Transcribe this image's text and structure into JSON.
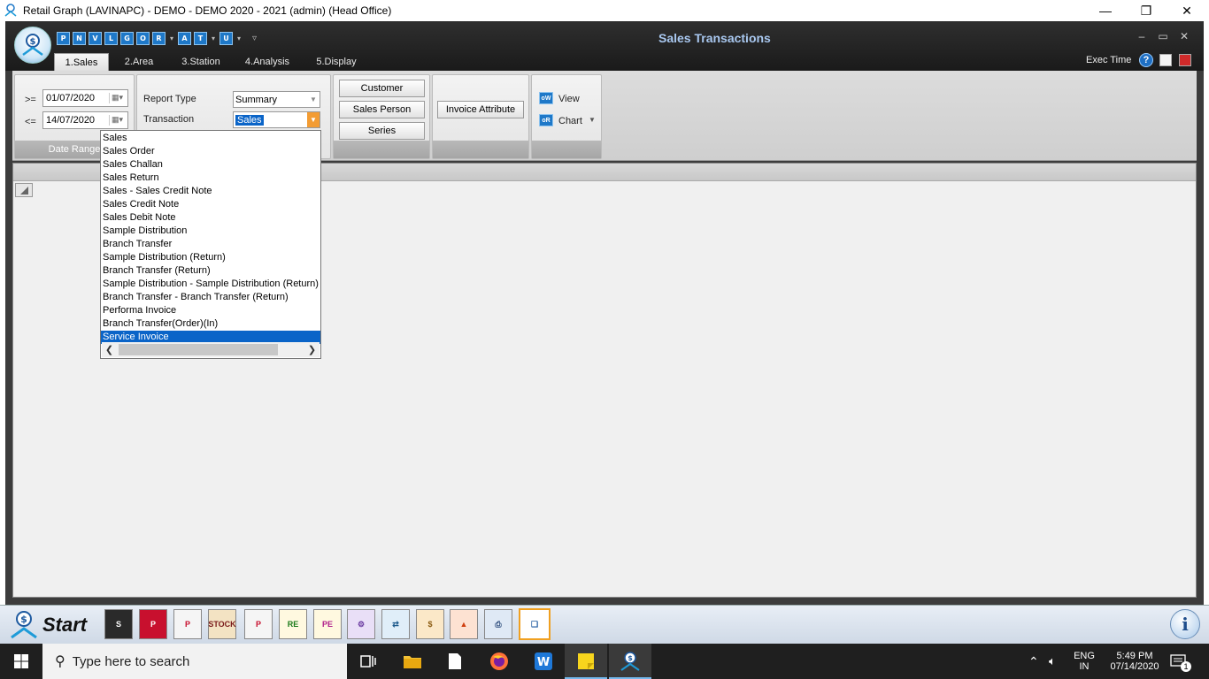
{
  "window": {
    "title": "Retail Graph (LAVINAPC) - DEMO - DEMO  2020 - 2021 (admin) (Head Office)",
    "minimize": "—",
    "restore": "❐",
    "close": "✕"
  },
  "app": {
    "title": "Sales Transactions",
    "quick_access": [
      {
        "label": "P",
        "icon": "p-report-icon",
        "has_menu": false
      },
      {
        "label": "N",
        "icon": "n-report-icon",
        "has_menu": false
      },
      {
        "label": "V",
        "icon": "v-report-icon",
        "has_menu": false
      },
      {
        "label": "L",
        "icon": "l-report-icon",
        "has_menu": false
      },
      {
        "label": "G",
        "icon": "g-report-icon",
        "has_menu": false
      },
      {
        "label": "O",
        "icon": "o-report-icon",
        "has_menu": false
      },
      {
        "label": "R",
        "icon": "r-report-icon",
        "has_menu": true
      },
      {
        "label": "A",
        "icon": "a-report-icon",
        "has_menu": false
      },
      {
        "label": "T",
        "icon": "t-report-icon",
        "has_menu": true
      },
      {
        "label": "U",
        "icon": "u-report-icon",
        "has_menu": true
      }
    ],
    "inner_controls": {
      "minimize": "‒",
      "restore": "▭",
      "close": "✕"
    }
  },
  "tabs": [
    {
      "label": "1.Sales",
      "active": true
    },
    {
      "label": "2.Area",
      "active": false
    },
    {
      "label": "3.Station",
      "active": false
    },
    {
      "label": "4.Analysis",
      "active": false
    },
    {
      "label": "5.Display",
      "active": false
    }
  ],
  "toolbar_right": {
    "exec_time_label": "Exec Time",
    "help": "?"
  },
  "date_range": {
    "group_label": "Date Range",
    "from_op": ">=",
    "from_date": "01/07/2020",
    "to_op": "<=",
    "to_date": "14/07/2020",
    "cal_glyph": "▦▾"
  },
  "report": {
    "report_type_label": "Report Type",
    "report_type_value": "Summary",
    "transaction_label": "Transaction",
    "transaction_value": "Sales"
  },
  "buttons": {
    "customer": "Customer",
    "sales_person": "Sales Person",
    "series": "Series",
    "invoice_attribute": "Invoice Attribute",
    "view": "View",
    "chart": "Chart"
  },
  "transaction_options": [
    "Sales",
    "Sales Order",
    "Sales Challan",
    "Sales Return",
    "Sales - Sales Credit Note",
    "Sales Credit Note",
    "Sales Debit Note",
    "Sample Distribution",
    "Branch Transfer",
    "Sample Distribution (Return)",
    "Branch Transfer (Return)",
    "Sample Distribution - Sample Distribution (Return)",
    "Branch Transfer - Branch Transfer (Return)",
    "Performa Invoice",
    "Branch Transfer(Order)(In)",
    "Service Invoice"
  ],
  "highlighted_option": "Service Invoice",
  "launcher": {
    "start_label": "Start",
    "icons": [
      {
        "name": "sales-ledger-icon",
        "label": "S",
        "bg": "#2a2a2a",
        "fg": "#fff"
      },
      {
        "name": "purchase-ledger-icon",
        "label": "P",
        "bg": "#c8102e",
        "fg": "#fff"
      },
      {
        "name": "purchase-entry-icon",
        "label": "P",
        "bg": "#f5f5f5",
        "fg": "#c8102e"
      },
      {
        "name": "stock-book-icon",
        "label": "STOCK",
        "bg": "#f3e3c3",
        "fg": "#7a1a1a"
      },
      {
        "name": "pos-icon",
        "label": "P",
        "bg": "#f5f5f5",
        "fg": "#c8102e"
      },
      {
        "name": "receipt-entry-icon",
        "label": "RE",
        "bg": "#fff9e0",
        "fg": "#1a7a1a"
      },
      {
        "name": "payment-entry-icon",
        "label": "PE",
        "bg": "#fff9e0",
        "fg": "#b0208c"
      },
      {
        "name": "user-tools-icon",
        "label": "⚙",
        "bg": "#e9dff7",
        "fg": "#6a3aa0"
      },
      {
        "name": "data-transfer-icon",
        "label": "⇄",
        "bg": "#e0eef9",
        "fg": "#1e5a8c"
      },
      {
        "name": "money-bag-icon",
        "label": "$",
        "bg": "#fbe8c8",
        "fg": "#8a5a10"
      },
      {
        "name": "shapes-icon",
        "label": "▲",
        "bg": "#fde2d2",
        "fg": "#d04010"
      },
      {
        "name": "printer-icon",
        "label": "⎙",
        "bg": "#dfe9f5",
        "fg": "#2a4a7a"
      },
      {
        "name": "copy-icon",
        "label": "❏",
        "bg": "#ffffff",
        "fg": "#1e5aa0"
      }
    ],
    "info": "i"
  },
  "taskbar": {
    "search_placeholder": "Type here to search",
    "lang_top": "ENG",
    "lang_bottom": "IN",
    "time": "5:49 PM",
    "date": "07/14/2020",
    "notifications": "1"
  }
}
